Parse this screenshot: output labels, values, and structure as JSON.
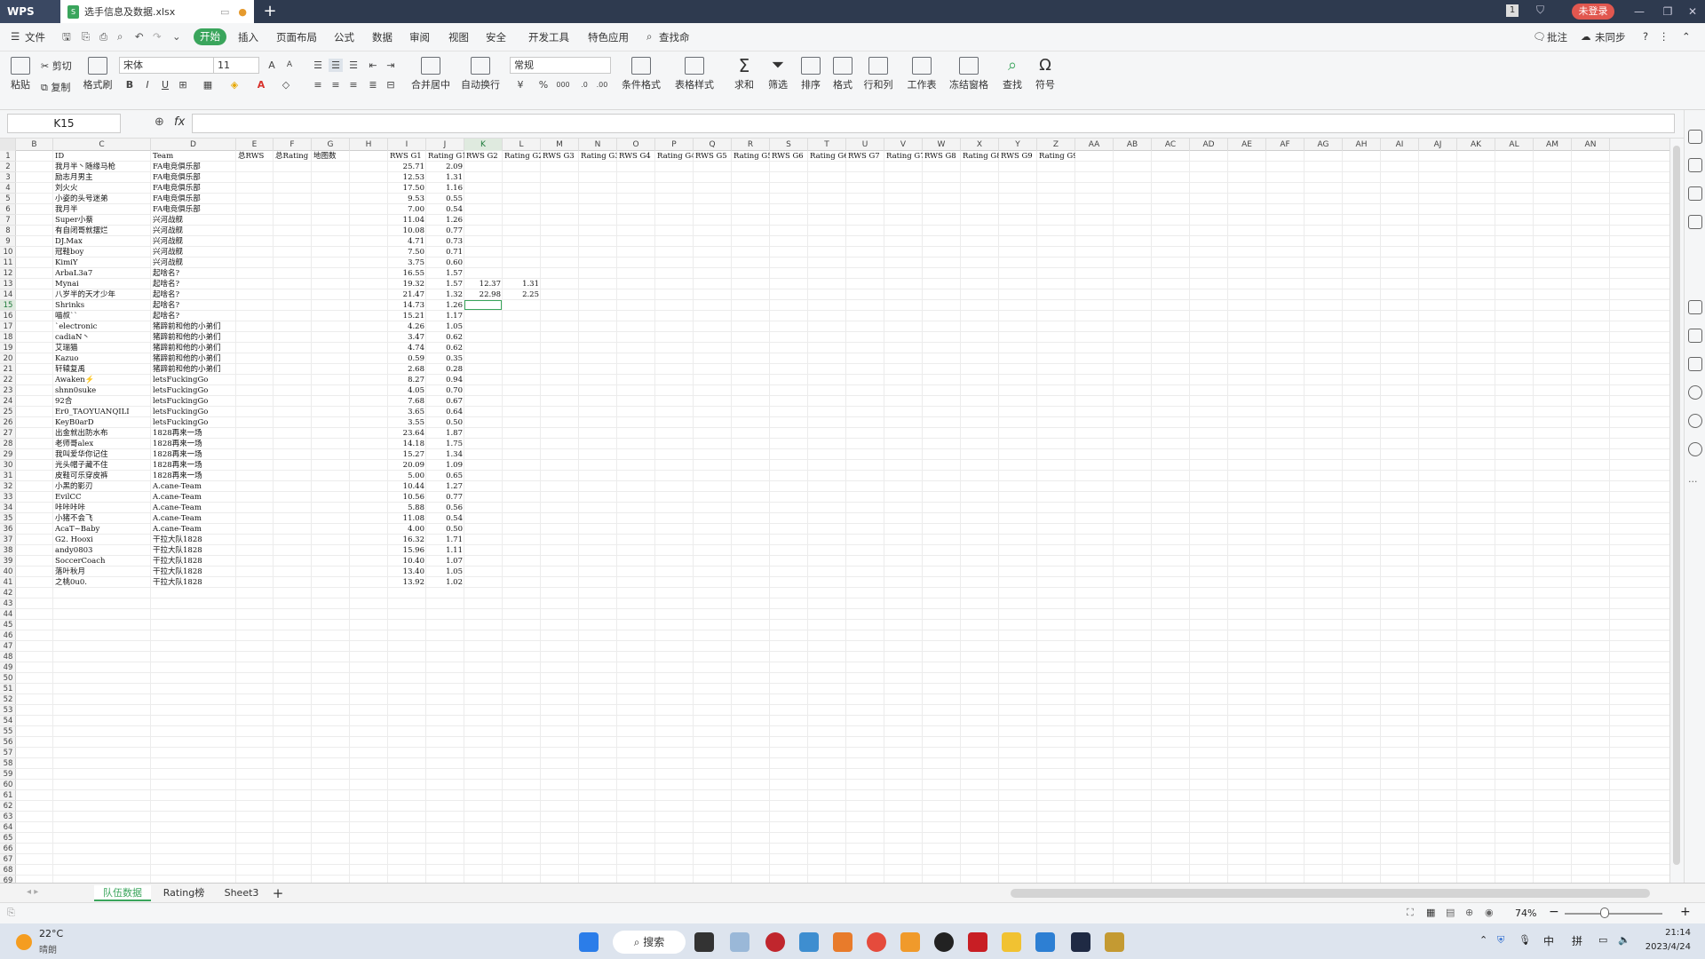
{
  "window": {
    "app_name": "WPS",
    "doc_tab": "选手信息及数据.xlsx",
    "login_label": "未登录",
    "page_badge": "1"
  },
  "menu": {
    "file": "文件",
    "items": [
      "开始",
      "插入",
      "页面布局",
      "公式",
      "数据",
      "审阅",
      "视图",
      "安全",
      "开发工具",
      "特色应用"
    ],
    "search": "查找命",
    "annotate": "批注",
    "sync": "未同步"
  },
  "ribbon": {
    "paste": "粘贴",
    "cut": "剪切",
    "copy": "复制",
    "format_painter": "格式刷",
    "font_name": "宋体",
    "font_size": "11",
    "merge_center": "合并居中",
    "wrap": "自动换行",
    "number_format": "常规",
    "cond_format": "条件格式",
    "table_style": "表格样式",
    "sum": "求和",
    "filter": "筛选",
    "sort": "排序",
    "format": "格式",
    "row_col": "行和列",
    "worksheet": "工作表",
    "freeze": "冻结窗格",
    "find": "查找",
    "symbol": "符号"
  },
  "formula": {
    "name_box": "K15",
    "fx": "fx",
    "value": ""
  },
  "columns": [
    "B",
    "C",
    "D",
    "E",
    "F",
    "G",
    "H",
    "I",
    "J",
    "K",
    "L",
    "M",
    "N",
    "O",
    "P",
    "Q",
    "R",
    "S",
    "T",
    "U",
    "V",
    "W",
    "X",
    "Y",
    "Z",
    "AA",
    "AB",
    "AC",
    "AD",
    "AE",
    "AF",
    "AG",
    "AH",
    "AI",
    "AJ",
    "AK",
    "AL",
    "AM",
    "AN"
  ],
  "header_row": [
    "ID",
    "Team",
    "总RWS",
    "总Rating",
    "地图数",
    "",
    "RWS G1",
    "Rating G1",
    "RWS G2",
    "Rating G2",
    "RWS G3",
    "Rating G3",
    "RWS G4",
    "Rating G4",
    "RWS G5",
    "Rating G5",
    "RWS G6",
    "Rating G6",
    "RWS G7",
    "Rating G7",
    "RWS G8",
    "Rating G8",
    "RWS G9",
    "Rating G9"
  ],
  "rows": [
    {
      "r": 2,
      "id": "我月半丶随缘马枪",
      "team": "FA电竞俱乐部",
      "rws": "25.71",
      "rating": "2.09"
    },
    {
      "r": 3,
      "id": "励志月男主",
      "team": "FA电竞俱乐部",
      "rws": "12.53",
      "rating": "1.31"
    },
    {
      "r": 4,
      "id": "刘火火",
      "team": "FA电竞俱乐部",
      "rws": "17.50",
      "rating": "1.16"
    },
    {
      "r": 5,
      "id": "小姿的头号迷弟",
      "team": "FA电竞俱乐部",
      "rws": "9.53",
      "rating": "0.55"
    },
    {
      "r": 6,
      "id": "我月半",
      "team": "FA电竞俱乐部",
      "rws": "7.00",
      "rating": "0.54"
    },
    {
      "r": 7,
      "id": "Super小蔡",
      "team": "兴河战舰",
      "rws": "11.04",
      "rating": "1.26"
    },
    {
      "r": 8,
      "id": "有自闭哥就摆烂",
      "team": "兴河战舰",
      "rws": "10.08",
      "rating": "0.77"
    },
    {
      "r": 9,
      "id": "DJ.Max",
      "team": "兴河战舰",
      "rws": "4.71",
      "rating": "0.73"
    },
    {
      "r": 10,
      "id": "冠鞋boy",
      "team": "兴河战舰",
      "rws": "7.50",
      "rating": "0.71"
    },
    {
      "r": 11,
      "id": "KimiY",
      "team": "兴河战舰",
      "rws": "3.75",
      "rating": "0.60"
    },
    {
      "r": 12,
      "id": "ArbaL3a7",
      "team": "起啥名?",
      "rws": "16.55",
      "rating": "1.57"
    },
    {
      "r": 13,
      "id": "Mynai",
      "team": "起啥名?",
      "rws": "19.32",
      "rating": "1.57",
      "rws2": "12.37",
      "rating2": "1.31"
    },
    {
      "r": 14,
      "id": "八岁半的天才少年",
      "team": "起啥名?",
      "rws": "21.47",
      "rating": "1.32",
      "rws2": "22.98",
      "rating2": "2.25"
    },
    {
      "r": 15,
      "id": "Shrinks",
      "team": "起啥名?",
      "rws": "14.73",
      "rating": "1.26"
    },
    {
      "r": 16,
      "id": "喵叔``",
      "team": "起啥名?",
      "rws": "15.21",
      "rating": "1.17"
    },
    {
      "r": 17,
      "id": "`electronic",
      "team": "猪蹄前和他的小弟们",
      "rws": "4.26",
      "rating": "1.05"
    },
    {
      "r": 18,
      "id": "cadiaN丶",
      "team": "猪蹄前和他的小弟们",
      "rws": "3.47",
      "rating": "0.62"
    },
    {
      "r": 19,
      "id": "艾瑞猫",
      "team": "猪蹄前和他的小弟们",
      "rws": "4.74",
      "rating": "0.62"
    },
    {
      "r": 20,
      "id": "Kazuo",
      "team": "猪蹄前和他的小弟们",
      "rws": "0.59",
      "rating": "0.35"
    },
    {
      "r": 21,
      "id": "轩辕复禹",
      "team": "猪蹄前和他的小弟们",
      "rws": "2.68",
      "rating": "0.28"
    },
    {
      "r": 22,
      "id": "Awaken⚡",
      "team": "letsFuckingGo",
      "rws": "8.27",
      "rating": "0.94"
    },
    {
      "r": 23,
      "id": "shnn0suke",
      "team": "letsFuckingGo",
      "rws": "4.05",
      "rating": "0.70"
    },
    {
      "r": 24,
      "id": "92合",
      "team": "letsFuckingGo",
      "rws": "7.68",
      "rating": "0.67"
    },
    {
      "r": 25,
      "id": "Er0_TAOYUANQILI",
      "team": "letsFuckingGo",
      "rws": "3.65",
      "rating": "0.64"
    },
    {
      "r": 26,
      "id": "KeyB0arD",
      "team": "letsFuckingGo",
      "rws": "3.55",
      "rating": "0.50"
    },
    {
      "r": 27,
      "id": "出金就出防水布",
      "team": "1828再来一场",
      "rws": "23.64",
      "rating": "1.87"
    },
    {
      "r": 28,
      "id": "老师哥alex",
      "team": "1828再来一场",
      "rws": "14.18",
      "rating": "1.75"
    },
    {
      "r": 29,
      "id": "我叫爱华你记住",
      "team": "1828再来一场",
      "rws": "15.27",
      "rating": "1.34"
    },
    {
      "r": 30,
      "id": "光头帽子藏不住",
      "team": "1828再来一场",
      "rws": "20.09",
      "rating": "1.09"
    },
    {
      "r": 31,
      "id": "皮鞋可乐穿皮裤",
      "team": "1828再来一场",
      "rws": "5.00",
      "rating": "0.65"
    },
    {
      "r": 32,
      "id": "小黑的影刃",
      "team": "A.cane-Team",
      "rws": "10.44",
      "rating": "1.27"
    },
    {
      "r": 33,
      "id": "EvilCC",
      "team": "A.cane-Team",
      "rws": "10.56",
      "rating": "0.77"
    },
    {
      "r": 34,
      "id": "咔咔咔咔",
      "team": "A.cane-Team",
      "rws": "5.88",
      "rating": "0.56"
    },
    {
      "r": 35,
      "id": "小猪不会飞",
      "team": "A.cane-Team",
      "rws": "11.08",
      "rating": "0.54"
    },
    {
      "r": 36,
      "id": "AcaT~Baby",
      "team": "A.cane-Team",
      "rws": "4.00",
      "rating": "0.50"
    },
    {
      "r": 37,
      "id": "G2. Hooxi",
      "team": "干拉大队1828",
      "rws": "16.32",
      "rating": "1.71"
    },
    {
      "r": 38,
      "id": "andy0803",
      "team": "干拉大队1828",
      "rws": "15.96",
      "rating": "1.11"
    },
    {
      "r": 39,
      "id": "SoccerCoach",
      "team": "干拉大队1828",
      "rws": "10.40",
      "rating": "1.07"
    },
    {
      "r": 40,
      "id": "落叶秋月",
      "team": "干拉大队1828",
      "rws": "13.40",
      "rating": "1.05"
    },
    {
      "r": 41,
      "id": "之桃0u0.",
      "team": "干拉大队1828",
      "rws": "13.92",
      "rating": "1.02"
    }
  ],
  "row_count": 69,
  "sheets": [
    "队伍数据",
    "Rating榜",
    "Sheet3"
  ],
  "status": {
    "zoom": "74%"
  },
  "taskbar": {
    "weather_temp": "22°C",
    "weather_desc": "晴朗",
    "search": "搜索",
    "ime1": "中",
    "ime2": "拼",
    "time": "21:14",
    "date": "2023/4/24"
  },
  "colors": {
    "accent": "#3aa55c",
    "titlebar": "#2e3a4f",
    "login": "#e1574f"
  }
}
